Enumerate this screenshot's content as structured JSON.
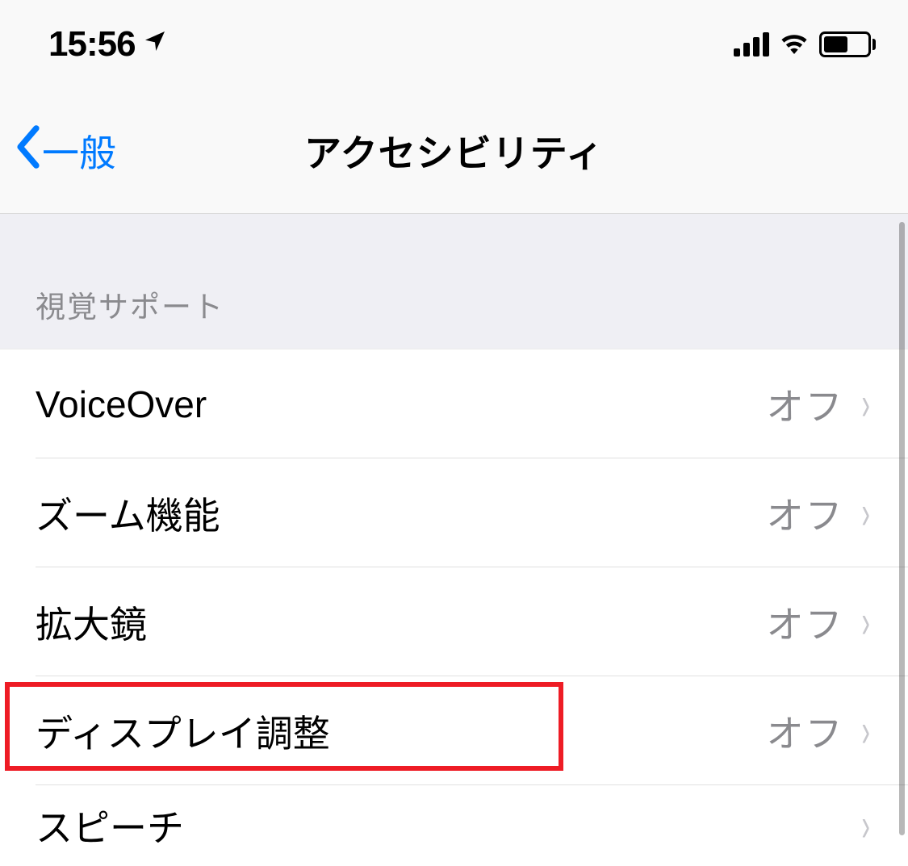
{
  "status_bar": {
    "time": "15:56",
    "location_enabled": true
  },
  "nav": {
    "back_label": "一般",
    "title": "アクセシビリティ"
  },
  "section": {
    "header": "視覚サポート"
  },
  "rows": [
    {
      "label": "VoiceOver",
      "value": "オフ"
    },
    {
      "label": "ズーム機能",
      "value": "オフ"
    },
    {
      "label": "拡大鏡",
      "value": "オフ"
    },
    {
      "label": "ディスプレイ調整",
      "value": "オフ"
    },
    {
      "label": "スピーチ",
      "value": ""
    }
  ],
  "highlight": {
    "row_index": 3
  }
}
